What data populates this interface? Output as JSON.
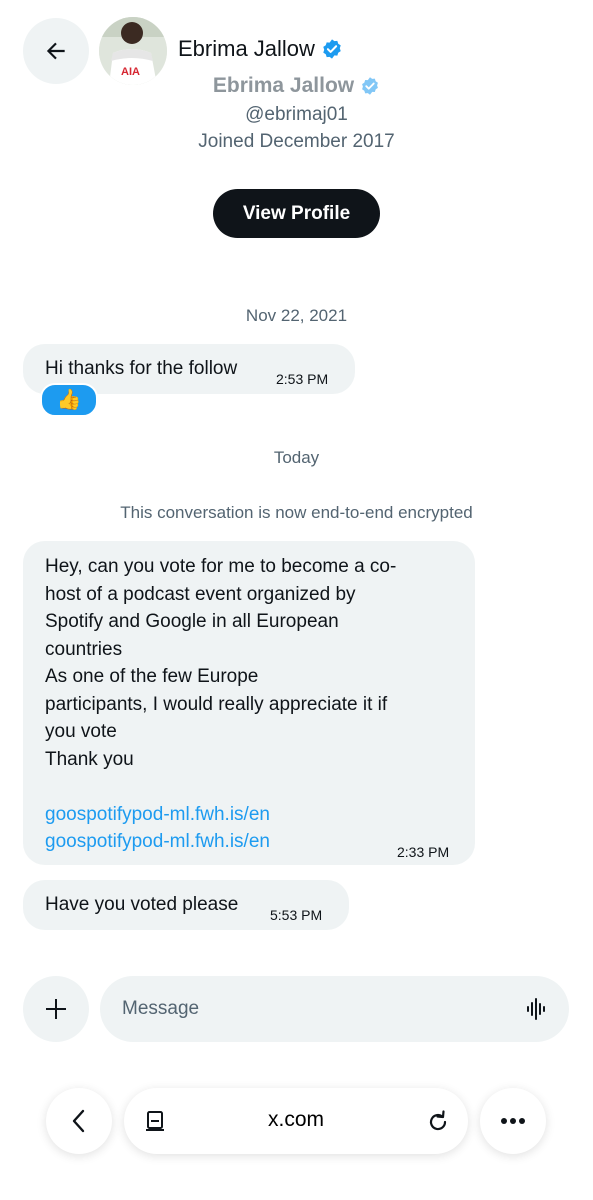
{
  "header": {
    "name": "Ebrima Jallow",
    "verified": true
  },
  "profile": {
    "name": "Ebrima Jallow",
    "handle": "@ebrimaj01",
    "joined": "Joined December 2017",
    "view_profile_label": "View Profile"
  },
  "conversation": {
    "date_1": "Nov 22, 2021",
    "message_1": {
      "text": "Hi thanks for the follow",
      "time": "2:53 PM",
      "reaction": "👍"
    },
    "date_2": "Today",
    "encryption_note": "This conversation is now end-to-end encrypted",
    "message_2": {
      "lines": [
        "Hey, can you vote for me to become a co-",
        "host of a podcast event organized by",
        "Spotify and Google in all European",
        "countries",
        "As one of the few Europe",
        "participants, I would really appreciate it if",
        "you vote",
        "Thank you"
      ],
      "links": [
        "goospotifypod-ml.fwh.is/en",
        "goospotifypod-ml.fwh.is/en"
      ],
      "time": "2:33 PM"
    },
    "message_3": {
      "text": "Have you voted please",
      "time": "5:53 PM"
    }
  },
  "composer": {
    "placeholder": "Message"
  },
  "browser": {
    "url": "x.com"
  },
  "colors": {
    "accent": "#1d9bf0",
    "bubble": "#eff3f4",
    "secondary_text": "#536471",
    "primary_text": "#0f1419"
  }
}
